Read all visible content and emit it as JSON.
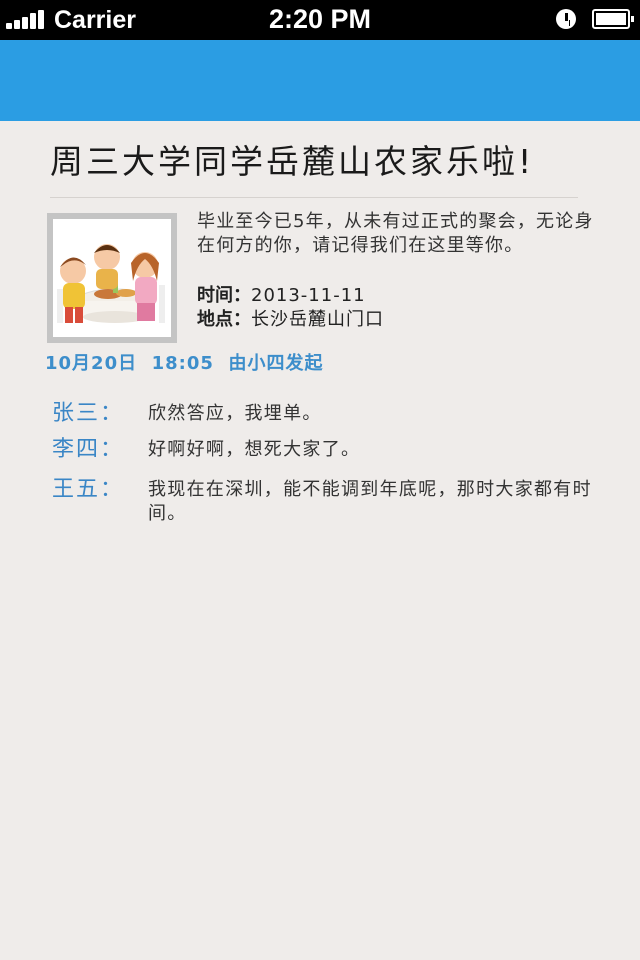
{
  "status_bar": {
    "carrier": "Carrier",
    "time": "2:20 PM"
  },
  "event": {
    "title": "周三大学同学岳麓山农家乐啦!",
    "description": "毕业至今已5年，从未有过正式的聚会，无论身在何方的你，请记得我们在这里等你。",
    "time_label": "时间：",
    "time_value": "2013-11-11",
    "place_label": "地点：",
    "place_value": "长沙岳麓山门口",
    "meta": "10月20日  18:05  由小四发起"
  },
  "comments": [
    {
      "name": "张三：",
      "text": "欣然答应，我埋单。"
    },
    {
      "name": "李四：",
      "text": "好啊好啊，想死大家了。"
    },
    {
      "name": "王五：",
      "text": "我现在在深圳，能不能调到年底呢，那时大家都有时间。"
    }
  ],
  "colors": {
    "navbar": "#2b9de3",
    "accent_text": "#3d8ecb",
    "background": "#efecea"
  }
}
